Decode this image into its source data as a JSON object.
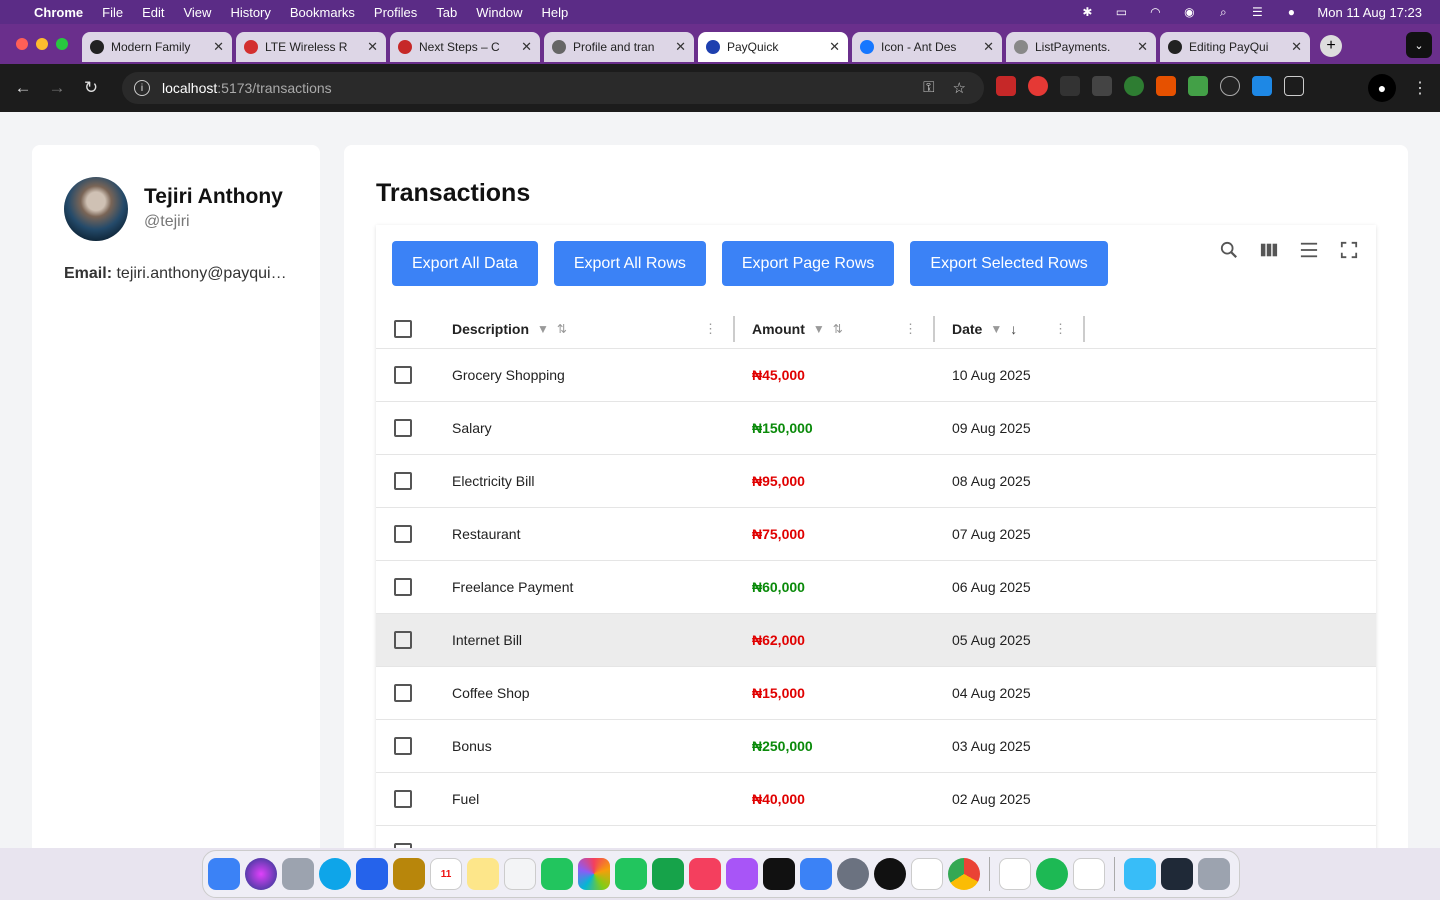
{
  "menubar": {
    "app": "Chrome",
    "items": [
      "File",
      "Edit",
      "View",
      "History",
      "Bookmarks",
      "Profiles",
      "Tab",
      "Window",
      "Help"
    ],
    "clock": "Mon 11 Aug  17:23"
  },
  "tabs": [
    {
      "label": "Modern Family",
      "color": "#222222"
    },
    {
      "label": "LTE Wireless R",
      "color": "#d32f2f"
    },
    {
      "label": "Next Steps – C",
      "color": "#c62828"
    },
    {
      "label": "Profile and tran",
      "color": "#666666"
    },
    {
      "label": "PayQuick",
      "color": "#1e40af"
    },
    {
      "label": "Icon - Ant Des",
      "color": "#1677ff"
    },
    {
      "label": "ListPayments.",
      "color": "#888888"
    },
    {
      "label": "Editing PayQui",
      "color": "#222222"
    }
  ],
  "address": {
    "host": "localhost",
    "path": ":5173/transactions"
  },
  "profile": {
    "name": "Tejiri Anthony",
    "handle": "@tejiri",
    "email_label": "Email:",
    "email": "tejiri.anthony@payquick.com"
  },
  "page": {
    "title": "Transactions"
  },
  "toolbar": {
    "export_all_data": "Export All Data",
    "export_all_rows": "Export All Rows",
    "export_page_rows": "Export Page Rows",
    "export_selected_rows": "Export Selected Rows"
  },
  "table": {
    "headers": {
      "description": "Description",
      "amount": "Amount",
      "date": "Date"
    },
    "rows": [
      {
        "description": "Grocery Shopping",
        "amount": "₦45,000",
        "type": "debit",
        "date": "10 Aug 2025"
      },
      {
        "description": "Salary",
        "amount": "₦150,000",
        "type": "credit",
        "date": "09 Aug 2025"
      },
      {
        "description": "Electricity Bill",
        "amount": "₦95,000",
        "type": "debit",
        "date": "08 Aug 2025"
      },
      {
        "description": "Restaurant",
        "amount": "₦75,000",
        "type": "debit",
        "date": "07 Aug 2025"
      },
      {
        "description": "Freelance Payment",
        "amount": "₦60,000",
        "type": "credit",
        "date": "06 Aug 2025"
      },
      {
        "description": "Internet Bill",
        "amount": "₦62,000",
        "type": "debit",
        "date": "05 Aug 2025"
      },
      {
        "description": "Coffee Shop",
        "amount": "₦15,000",
        "type": "debit",
        "date": "04 Aug 2025"
      },
      {
        "description": "Bonus",
        "amount": "₦250,000",
        "type": "credit",
        "date": "03 Aug 2025"
      },
      {
        "description": "Fuel",
        "amount": "₦40,000",
        "type": "debit",
        "date": "02 Aug 2025"
      }
    ]
  },
  "colors": {
    "accent": "#3b82f6",
    "debit": "#e00000",
    "credit": "#0a8a0a"
  }
}
